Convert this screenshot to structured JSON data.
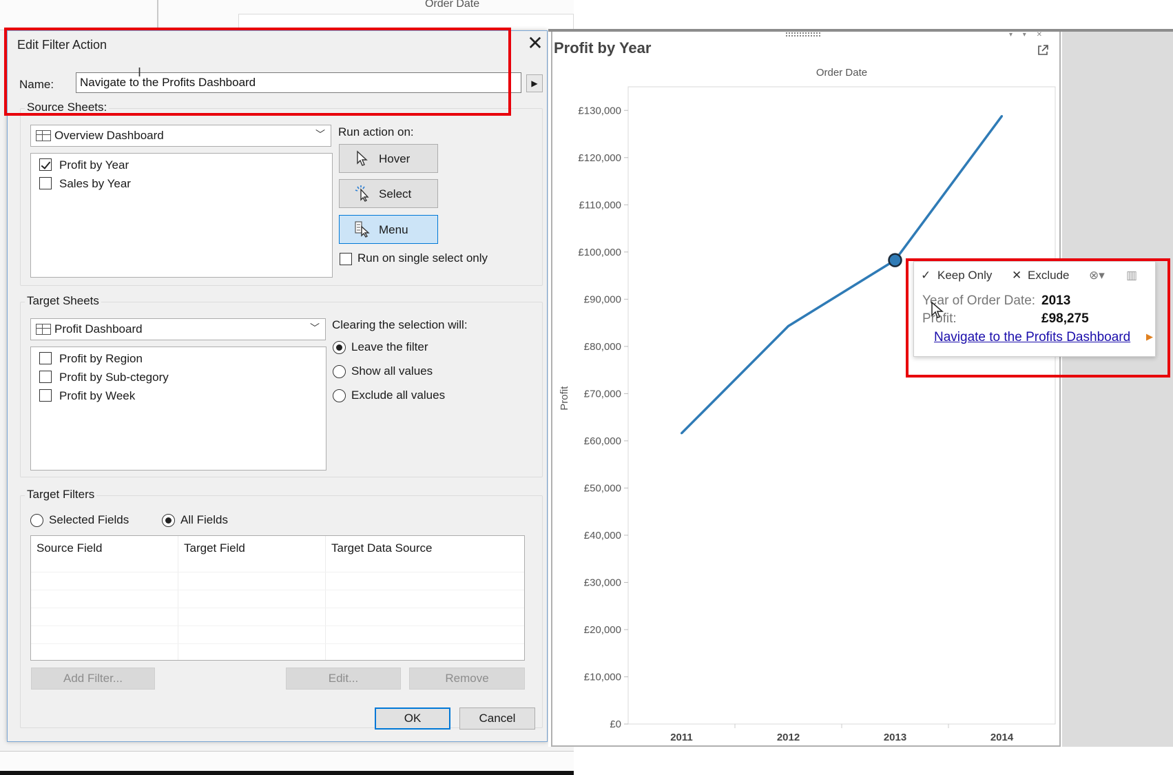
{
  "background": {
    "top_header": "Order Date"
  },
  "dialog": {
    "title": "Edit Filter Action",
    "close_label": "✕",
    "name_label": "Name:",
    "name_value": "Navigate to the Profits Dashboard",
    "source_sheets": {
      "label": "Source Sheets:",
      "selected_source": "Overview Dashboard",
      "items": [
        {
          "label": "Profit by Year",
          "checked": true
        },
        {
          "label": "Sales by Year",
          "checked": false
        }
      ]
    },
    "run_action": {
      "label": "Run action on:",
      "buttons": [
        {
          "label": "Hover",
          "active": false
        },
        {
          "label": "Select",
          "active": false
        },
        {
          "label": "Menu",
          "active": true
        }
      ],
      "single_select_label": "Run on single select only",
      "single_select_checked": false
    },
    "target_sheets": {
      "label": "Target Sheets",
      "selected_target": "Profit Dashboard",
      "items": [
        {
          "label": "Profit by Region",
          "checked": false
        },
        {
          "label": "Profit by Sub-ctegory",
          "checked": false
        },
        {
          "label": "Profit by Week",
          "checked": false
        }
      ]
    },
    "clearing": {
      "label": "Clearing the selection will:",
      "options": [
        {
          "label": "Leave the filter",
          "selected": true
        },
        {
          "label": "Show all values",
          "selected": false
        },
        {
          "label": "Exclude all values",
          "selected": false
        }
      ]
    },
    "target_filters": {
      "label": "Target Filters",
      "options": [
        {
          "label": "Selected Fields",
          "selected": false
        },
        {
          "label": "All Fields",
          "selected": true
        }
      ],
      "columns": [
        "Source Field",
        "Target Field",
        "Target Data Source"
      ]
    },
    "buttons": {
      "add_filter": "Add Filter...",
      "edit": "Edit...",
      "remove": "Remove",
      "ok": "OK",
      "cancel": "Cancel"
    }
  },
  "chart_panel": {
    "title": "Profit by Year",
    "colors": {
      "line": "#2f7bb6",
      "highlight_box": "#e8000b"
    }
  },
  "chart_data": {
    "type": "line",
    "title": "Profit by Year",
    "xlabel": "Order Date",
    "ylabel": "Profit",
    "categories": [
      "2011",
      "2012",
      "2013",
      "2014"
    ],
    "series": [
      {
        "values": [
          61600,
          84300,
          98275,
          128800
        ]
      }
    ],
    "ylim": [
      0,
      135000
    ],
    "yticks": [
      0,
      10000,
      20000,
      30000,
      40000,
      50000,
      60000,
      70000,
      80000,
      90000,
      100000,
      110000,
      120000,
      130000
    ],
    "ytick_labels": [
      "£0",
      "£10,000",
      "£20,000",
      "£30,000",
      "£40,000",
      "£50,000",
      "£60,000",
      "£70,000",
      "£80,000",
      "£90,000",
      "£100,000",
      "£110,000",
      "£120,000",
      "£130,000"
    ],
    "highlighted_point": 2,
    "grid": false
  },
  "tooltip": {
    "keep_only": "Keep Only",
    "exclude": "Exclude",
    "field1_label": "Year of Order Date:",
    "field1_value": "2013",
    "field2_label": "Profit:",
    "field2_value": "£98,275",
    "link": "Navigate to the Profits Dashboard"
  }
}
